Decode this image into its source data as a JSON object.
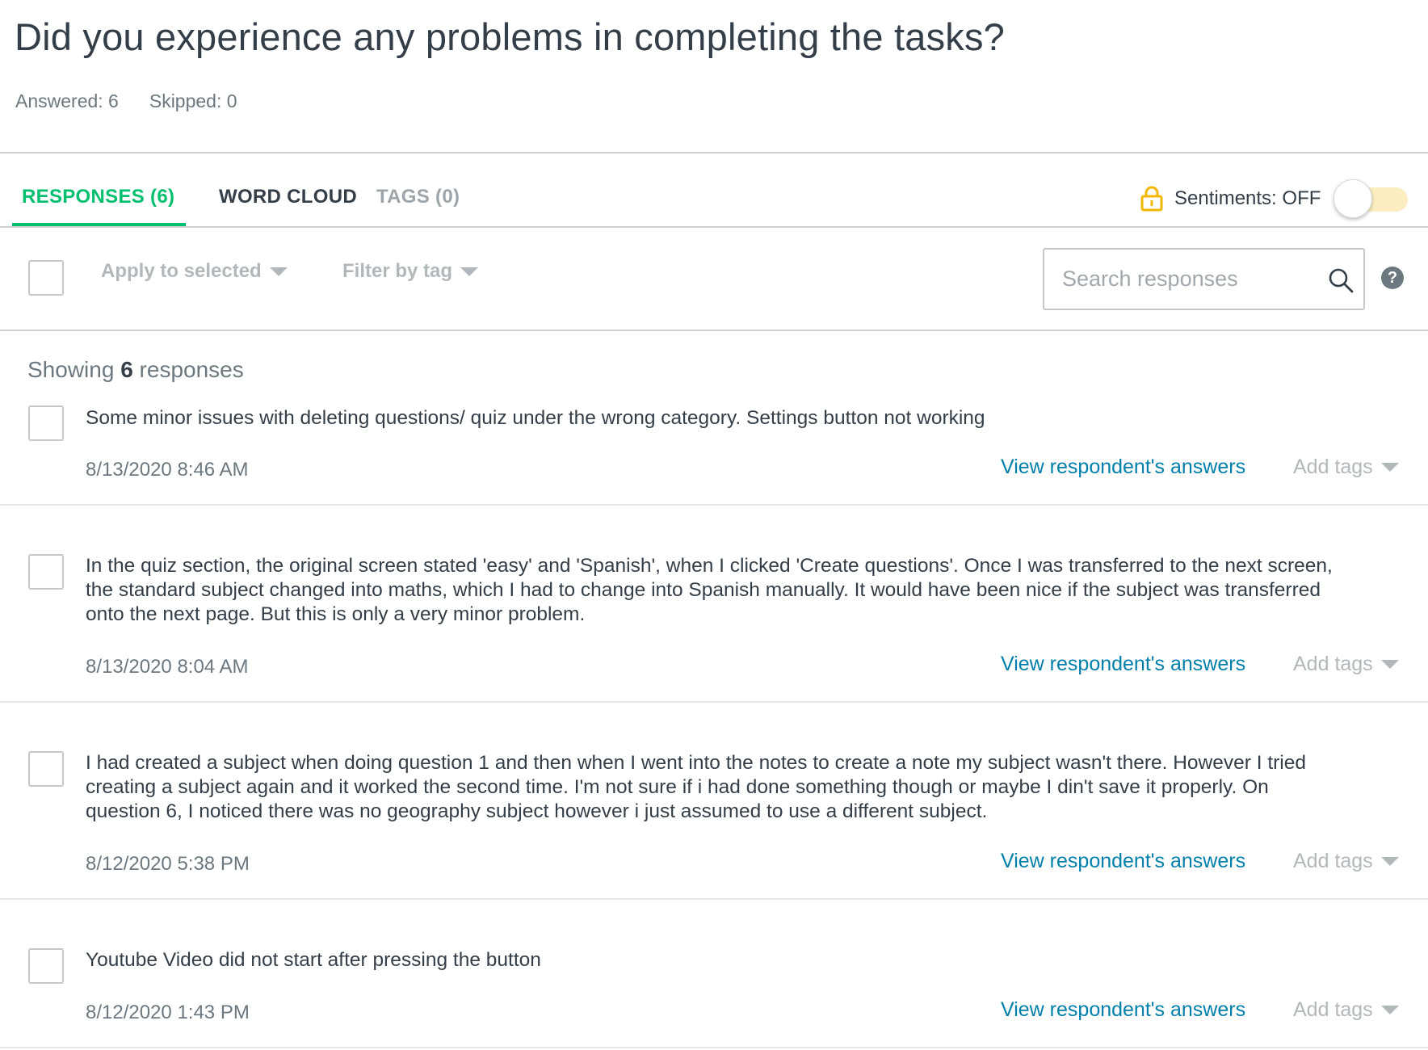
{
  "question": {
    "title": "Did you experience any problems in completing the tasks?",
    "answered": "Answered: 6",
    "skipped": "Skipped: 0"
  },
  "tabs": [
    {
      "label": "RESPONSES (6)",
      "active": true
    },
    {
      "label": "WORD CLOUD",
      "active": false
    },
    {
      "label": "TAGS (0)",
      "active": false
    }
  ],
  "sentiments": {
    "label": "Sentiments: OFF",
    "enabled": false,
    "lock_icon": "lock-icon"
  },
  "toolbar": {
    "apply_label": "Apply to selected",
    "filter_label": "Filter by tag",
    "search_placeholder": "Search responses",
    "help_glyph": "?"
  },
  "showing": {
    "prefix": "Showing",
    "count": "6",
    "suffix": "responses"
  },
  "responses": [
    {
      "text": "Some minor issues with deleting questions/ quiz under the wrong category. Settings button not working",
      "date": "8/13/2020 8:46 AM",
      "link": "View respondent's answers",
      "tags": "Add tags"
    },
    {
      "text": "In the quiz section, the original screen stated 'easy' and 'Spanish', when I clicked 'Create questions'. Once I was transferred to the next screen, the standard subject changed into maths, which I had to change into Spanish manually. It would have been nice if the subject was transferred onto the next page. But this is only a very minor problem.",
      "date": "8/13/2020 8:04 AM",
      "link": "View respondent's answers",
      "tags": "Add tags"
    },
    {
      "text": "I had created a subject when doing question 1 and then when I went into the notes to create a note my subject wasn't there. However I tried creating a subject again and it worked the second time. I'm not sure if i had done something though or maybe I din't save it properly. On question 6, I noticed there was no geography subject however i just assumed to use a different subject.",
      "date": "8/12/2020 5:38 PM",
      "link": "View respondent's answers",
      "tags": "Add tags"
    },
    {
      "text": "Youtube Video did not start after pressing the button",
      "date": "8/12/2020 1:43 PM",
      "link": "View respondent's answers",
      "tags": "Add tags"
    }
  ],
  "colors": {
    "accent": "#00bf6f",
    "link": "#007faa",
    "lock": "#f2b705",
    "toggle_track": "#fdeec1"
  }
}
